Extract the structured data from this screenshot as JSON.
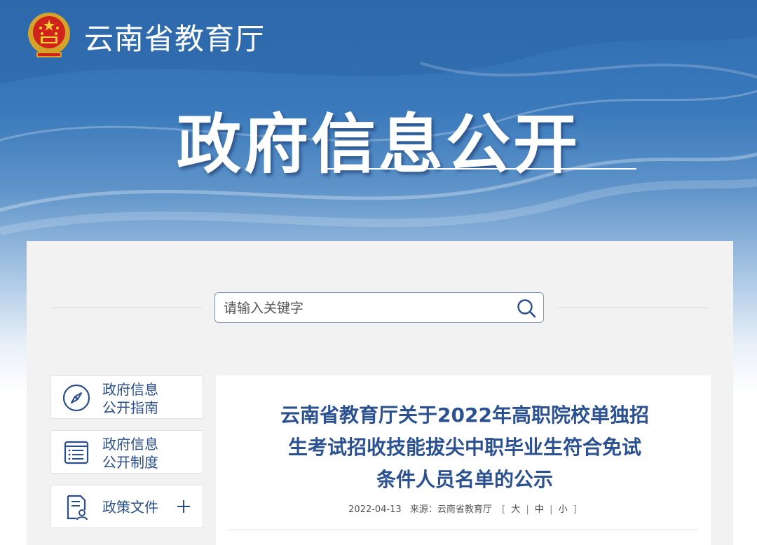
{
  "header": {
    "org_name": "云南省教育厅",
    "section_title": "政府信息公开"
  },
  "search": {
    "placeholder": "请输入关键字"
  },
  "sidebar": {
    "items": [
      {
        "label_line1": "政府信息",
        "label_line2": "公开指南",
        "icon": "compass-icon"
      },
      {
        "label_line1": "政府信息",
        "label_line2": "公开制度",
        "icon": "list-document-icon"
      },
      {
        "label": "政策文件",
        "icon": "policy-document-icon",
        "expand_icon": "plus-icon"
      }
    ]
  },
  "article": {
    "title_line1": "云南省教育厅关于2022年高职院校单独招",
    "title_line2": "生考试招收技能拔尖中职毕业生符合免试",
    "title_line3": "条件人员名单的公示",
    "date": "2022-04-13",
    "source": "来源：云南省教育厅",
    "font_size_open": "[",
    "font_size_large": "大",
    "font_size_medium": "中",
    "font_size_small": "小",
    "font_size_close": "]",
    "separator": "|"
  },
  "colors": {
    "banner_top": "#2f6db0",
    "title_blue": "#2b5191",
    "sidebar_text": "#2a4e8a",
    "panel_bg": "#f2f2f2"
  }
}
